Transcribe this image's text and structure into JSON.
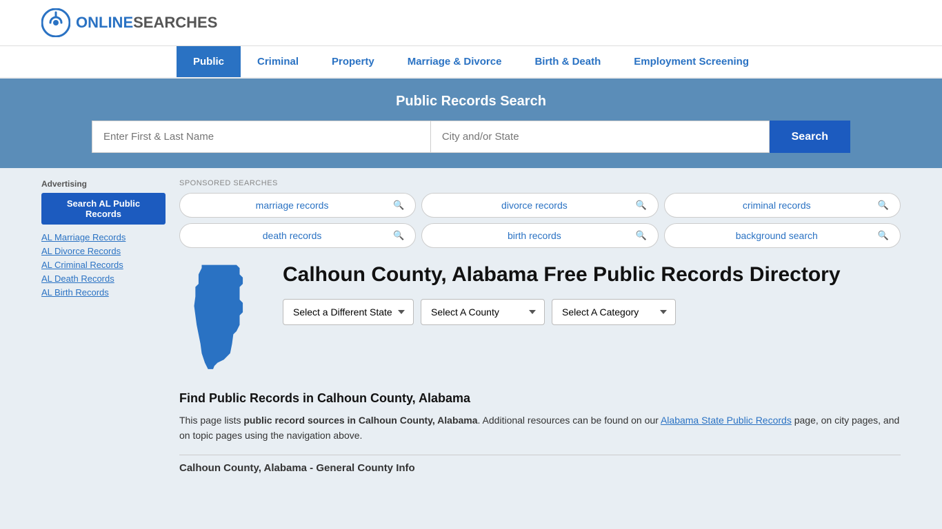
{
  "logo": {
    "icon_label": "OnlineSearches logo icon",
    "text_online": "ONLINE",
    "text_searches": "SEARCHES"
  },
  "nav": {
    "items": [
      {
        "label": "Public",
        "active": true
      },
      {
        "label": "Criminal",
        "active": false
      },
      {
        "label": "Property",
        "active": false
      },
      {
        "label": "Marriage & Divorce",
        "active": false
      },
      {
        "label": "Birth & Death",
        "active": false
      },
      {
        "label": "Employment Screening",
        "active": false
      }
    ]
  },
  "search_banner": {
    "title": "Public Records Search",
    "name_placeholder": "Enter First & Last Name",
    "location_placeholder": "City and/or State",
    "button_label": "Search"
  },
  "sponsored": {
    "label": "SPONSORED SEARCHES",
    "items": [
      "marriage records",
      "divorce records",
      "criminal records",
      "death records",
      "birth records",
      "background search"
    ]
  },
  "county": {
    "title": "Calhoun County, Alabama Free Public Records Directory",
    "dropdowns": {
      "state_label": "Select a Different State",
      "county_label": "Select A County",
      "category_label": "Select A Category"
    }
  },
  "find_section": {
    "title": "Find Public Records in Calhoun County, Alabama",
    "description_prefix": "This page lists ",
    "description_bold": "public record sources in Calhoun County, Alabama",
    "description_mid": ". Additional resources can be found on our ",
    "link_text": "Alabama State Public Records",
    "description_suffix": " page, on city pages, and on topic pages using the navigation above."
  },
  "general_info_heading": "Calhoun County, Alabama - General County Info",
  "sidebar": {
    "ad_label": "Advertising",
    "search_btn_label": "Search AL Public Records",
    "links": [
      "AL Marriage Records",
      "AL Divorce Records",
      "AL Criminal Records",
      "AL Death Records",
      "AL Birth Records"
    ]
  }
}
